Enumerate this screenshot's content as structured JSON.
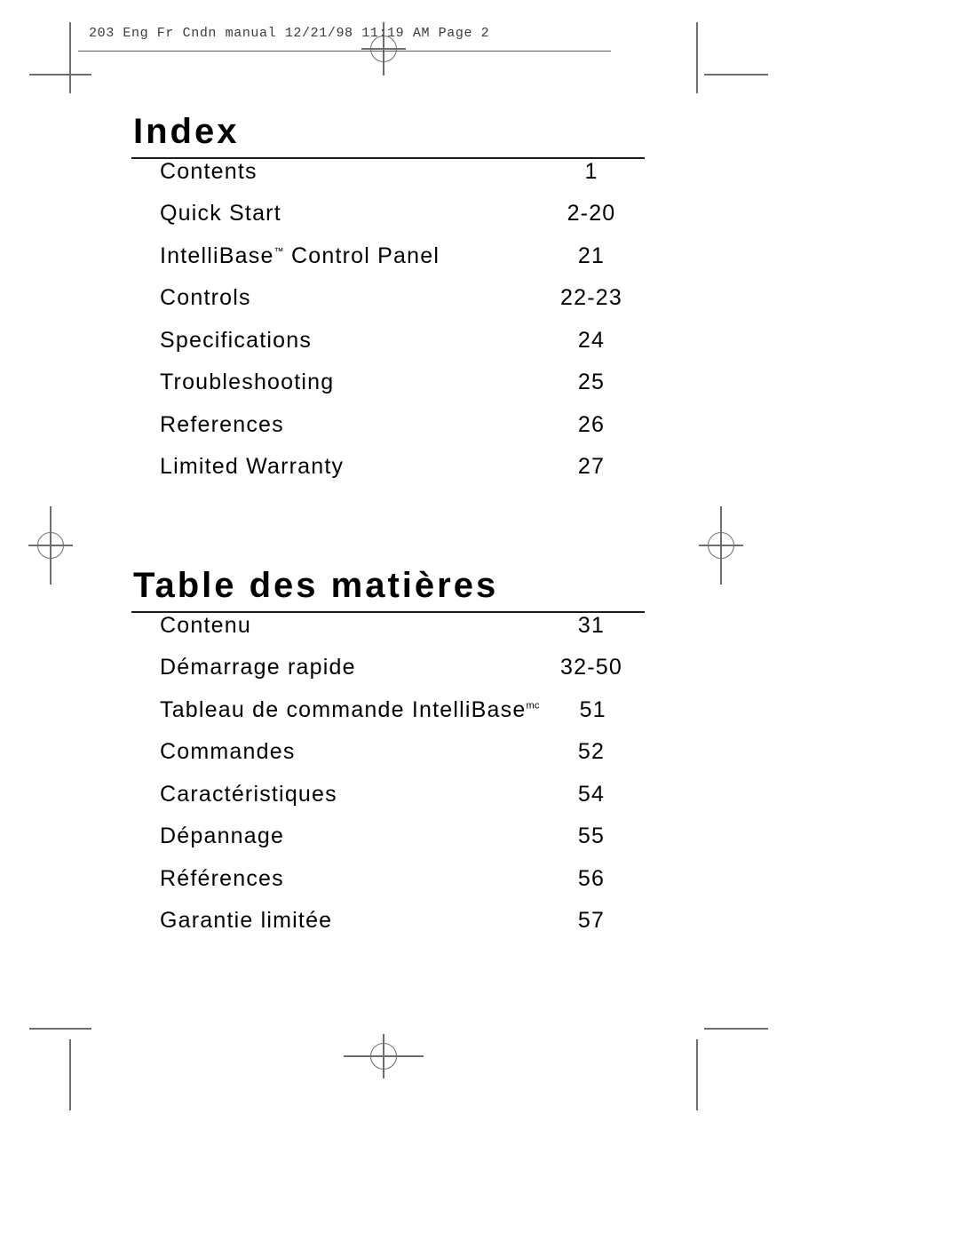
{
  "slug": {
    "text": "203 Eng Fr Cndn manual   12/21/98 11:19 AM   Page 2"
  },
  "sections": [
    {
      "id": "index",
      "heading": "Index",
      "language": "en",
      "entries": [
        {
          "label": "Contents",
          "suffix": "",
          "page": "1"
        },
        {
          "label": "Quick Start",
          "suffix": "",
          "page": "2-20"
        },
        {
          "label": "IntelliBase",
          "suffix": "™ Control Panel",
          "superscript": "™",
          "label_tail": " Control Panel",
          "page": "21"
        },
        {
          "label": "Controls",
          "suffix": "",
          "page": "22-23"
        },
        {
          "label": "Specifications",
          "suffix": "",
          "page": "24"
        },
        {
          "label": "Troubleshooting",
          "suffix": "",
          "page": "25"
        },
        {
          "label": "References",
          "suffix": "",
          "page": "26"
        },
        {
          "label": "Limited Warranty",
          "suffix": "",
          "page": "27"
        }
      ]
    },
    {
      "id": "table-des-matieres",
      "heading": "Table des matières",
      "language": "fr",
      "entries": [
        {
          "label": "Contenu",
          "suffix": "",
          "page": "31"
        },
        {
          "label": "Démarrage rapide",
          "suffix": "",
          "page": "32-50"
        },
        {
          "label": "Tableau de commande IntelliBase",
          "suffix": "mc",
          "superscript": "mc",
          "label_tail": "",
          "page": "51"
        },
        {
          "label": "Commandes",
          "suffix": "",
          "page": "52"
        },
        {
          "label": "Caractéristiques",
          "suffix": "",
          "page": "54"
        },
        {
          "label": "Dépannage",
          "suffix": "",
          "page": "55"
        },
        {
          "label": "Références",
          "suffix": "",
          "page": "56"
        },
        {
          "label": "Garantie limitée",
          "suffix": "",
          "page": "57"
        }
      ]
    }
  ],
  "colors": {
    "text": "#000000",
    "rule": "#1a1a1a",
    "marks": "#6e6e6e",
    "slug_text": "#3b3b3b",
    "page_background": "#ffffff"
  }
}
